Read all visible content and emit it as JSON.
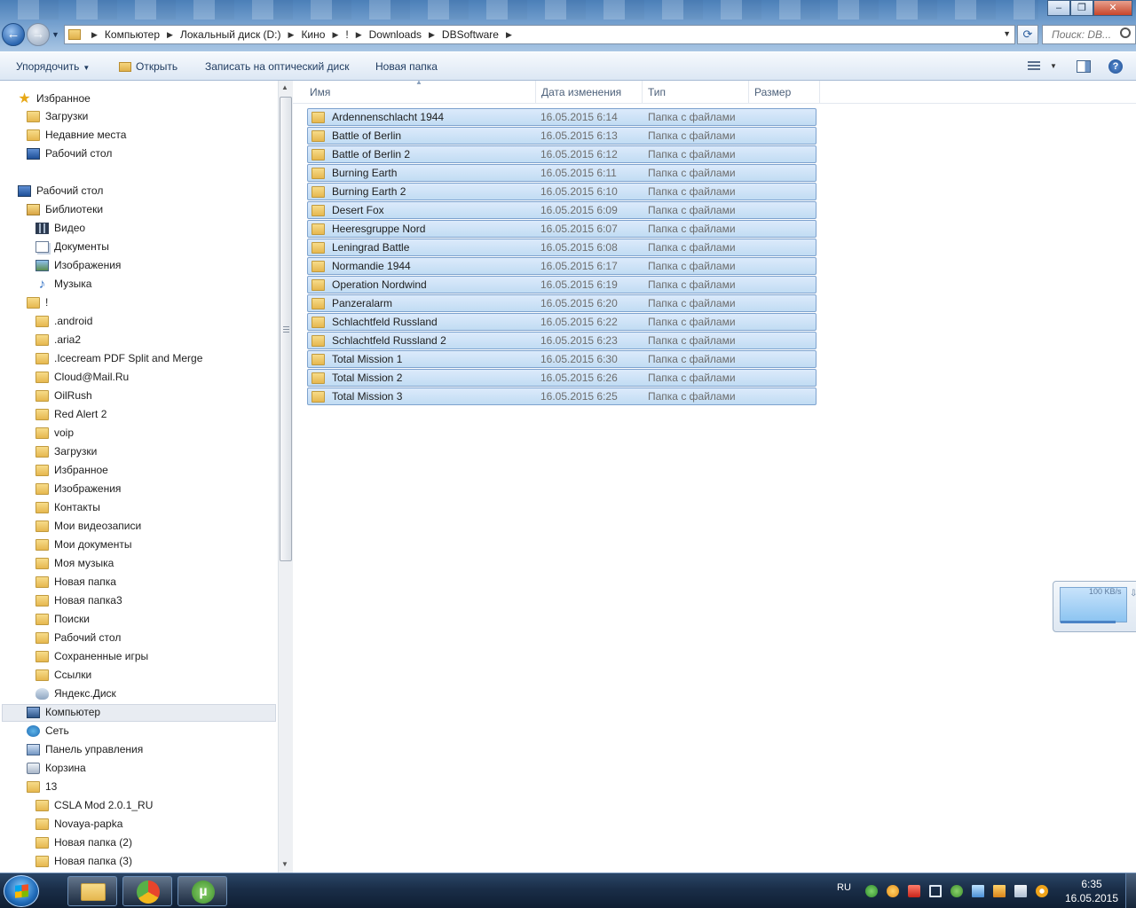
{
  "window": {
    "minimize_label": "‒",
    "maximize_label": "❐",
    "close_label": "✕"
  },
  "address": {
    "crumbs": [
      "Компьютер",
      "Локальный диск (D:)",
      "Кино",
      "!",
      "Downloads",
      "DBSoftware"
    ],
    "search_placeholder": "Поиск: DB..."
  },
  "toolbar": {
    "organize": "Упорядочить",
    "open": "Открыть",
    "burn": "Записать на оптический диск",
    "new_folder": "Новая папка"
  },
  "nav": {
    "items": [
      {
        "label": "Избранное",
        "icon": "star-icon"
      },
      {
        "label": "Загрузки",
        "icon": "downloads-folder-icon"
      },
      {
        "label": "Недавние места",
        "icon": "recent-places-icon"
      },
      {
        "label": "Рабочий стол",
        "icon": "desktop-icon"
      },
      {
        "label": "Рабочий стол",
        "icon": "desktop-icon"
      },
      {
        "label": "Библиотеки",
        "icon": "libraries-icon"
      },
      {
        "label": "Видео",
        "icon": "video-library-icon"
      },
      {
        "label": "Документы",
        "icon": "documents-library-icon"
      },
      {
        "label": "Изображения",
        "icon": "pictures-library-icon"
      },
      {
        "label": "Музыка",
        "icon": "music-library-icon"
      },
      {
        "label": "!",
        "icon": "user-folder-icon"
      },
      {
        "label": ".android",
        "icon": "folder-icon"
      },
      {
        "label": ".aria2",
        "icon": "folder-icon"
      },
      {
        "label": ".Icecream PDF Split and Merge",
        "icon": "folder-icon"
      },
      {
        "label": "Cloud@Mail.Ru",
        "icon": "folder-icon"
      },
      {
        "label": "OilRush",
        "icon": "folder-icon"
      },
      {
        "label": "Red Alert 2",
        "icon": "folder-icon"
      },
      {
        "label": "voip",
        "icon": "folder-icon"
      },
      {
        "label": "Загрузки",
        "icon": "downloads-folder-icon"
      },
      {
        "label": "Избранное",
        "icon": "favorites-folder-icon"
      },
      {
        "label": "Изображения",
        "icon": "pictures-folder-icon"
      },
      {
        "label": "Контакты",
        "icon": "contacts-folder-icon"
      },
      {
        "label": "Мои видеозаписи",
        "icon": "videos-folder-icon"
      },
      {
        "label": "Мои документы",
        "icon": "documents-folder-icon"
      },
      {
        "label": "Моя музыка",
        "icon": "music-folder-icon"
      },
      {
        "label": "Новая папка",
        "icon": "folder-icon"
      },
      {
        "label": "Новая папка3",
        "icon": "folder-icon"
      },
      {
        "label": "Поиски",
        "icon": "searches-folder-icon"
      },
      {
        "label": "Рабочий стол",
        "icon": "desktop-folder-icon"
      },
      {
        "label": "Сохраненные игры",
        "icon": "saved-games-folder-icon"
      },
      {
        "label": "Ссылки",
        "icon": "links-folder-icon"
      },
      {
        "label": "Яндекс.Диск",
        "icon": "yandex-disk-icon"
      },
      {
        "label": "Компьютер",
        "icon": "computer-icon"
      },
      {
        "label": "Сеть",
        "icon": "network-icon"
      },
      {
        "label": "Панель управления",
        "icon": "control-panel-icon"
      },
      {
        "label": "Корзина",
        "icon": "recycle-bin-icon"
      },
      {
        "label": "13",
        "icon": "folder-icon"
      },
      {
        "label": "CSLA Mod 2.0.1_RU",
        "icon": "folder-icon"
      },
      {
        "label": "Novaya-papka",
        "icon": "folder-icon"
      },
      {
        "label": "Новая папка (2)",
        "icon": "folder-icon"
      },
      {
        "label": "Новая папка (3)",
        "icon": "folder-icon"
      }
    ]
  },
  "files": {
    "headers": {
      "name": "Имя",
      "date": "Дата изменения",
      "type": "Тип",
      "size": "Размер"
    },
    "rows": [
      {
        "name": "Ardennenschlacht 1944",
        "date": "16.05.2015 6:14",
        "type": "Папка с файлами"
      },
      {
        "name": "Battle of Berlin",
        "date": "16.05.2015 6:13",
        "type": "Папка с файлами"
      },
      {
        "name": "Battle of Berlin 2",
        "date": "16.05.2015 6:12",
        "type": "Папка с файлами"
      },
      {
        "name": "Burning Earth",
        "date": "16.05.2015 6:11",
        "type": "Папка с файлами"
      },
      {
        "name": "Burning Earth 2",
        "date": "16.05.2015 6:10",
        "type": "Папка с файлами"
      },
      {
        "name": "Desert Fox",
        "date": "16.05.2015 6:09",
        "type": "Папка с файлами"
      },
      {
        "name": "Heeresgruppe Nord",
        "date": "16.05.2015 6:07",
        "type": "Папка с файлами"
      },
      {
        "name": "Leningrad Battle",
        "date": "16.05.2015 6:08",
        "type": "Папка с файлами"
      },
      {
        "name": "Normandie 1944",
        "date": "16.05.2015 6:17",
        "type": "Папка с файлами"
      },
      {
        "name": "Operation Nordwind",
        "date": "16.05.2015 6:19",
        "type": "Папка с файлами"
      },
      {
        "name": "Panzeralarm",
        "date": "16.05.2015 6:20",
        "type": "Папка с файлами"
      },
      {
        "name": "Schlachtfeld Russland",
        "date": "16.05.2015 6:22",
        "type": "Папка с файлами"
      },
      {
        "name": "Schlachtfeld Russland 2",
        "date": "16.05.2015 6:23",
        "type": "Папка с файлами"
      },
      {
        "name": "Total Mission 1",
        "date": "16.05.2015 6:30",
        "type": "Папка с файлами"
      },
      {
        "name": "Total Mission 2",
        "date": "16.05.2015 6:26",
        "type": "Папка с файлами"
      },
      {
        "name": "Total Mission 3",
        "date": "16.05.2015 6:25",
        "type": "Папка с файлами"
      }
    ]
  },
  "widget": {
    "speed_label": "100 KB/s"
  },
  "taskbar": {
    "language": "RU",
    "time": "6:35",
    "date": "16.05.2015"
  }
}
